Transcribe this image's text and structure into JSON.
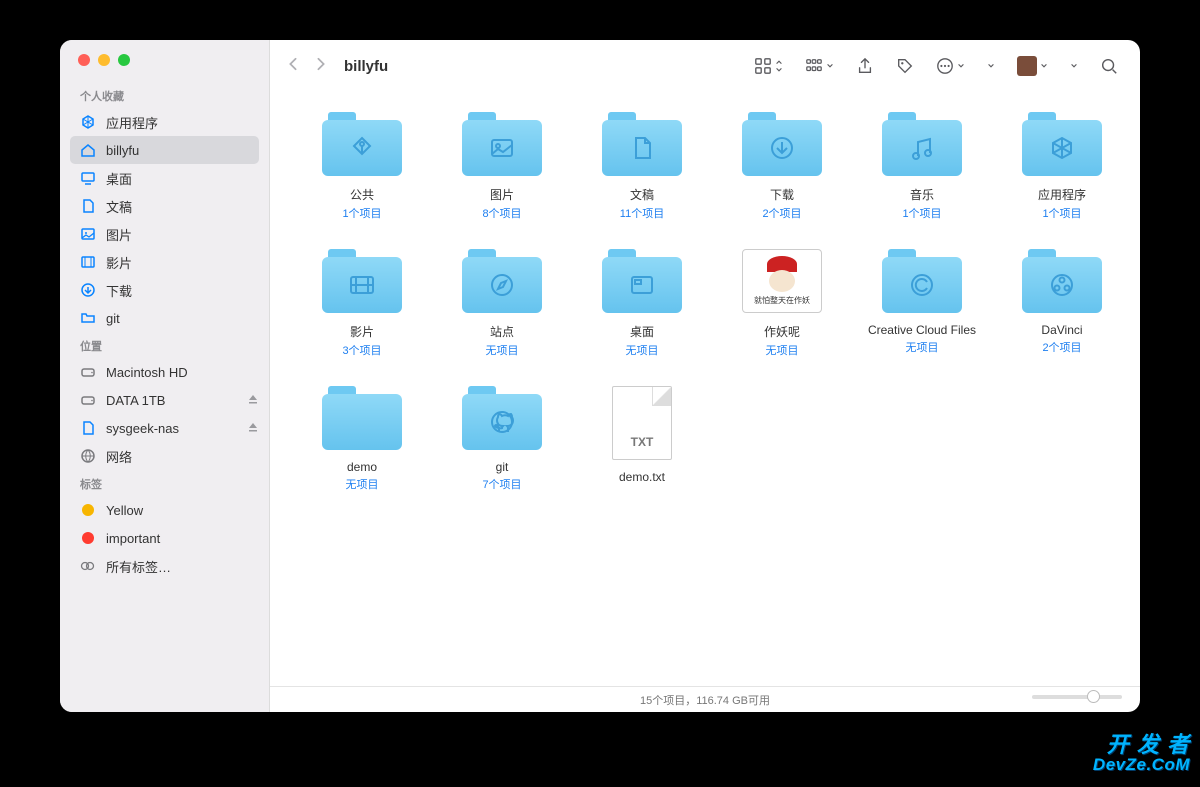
{
  "window": {
    "title": "billyfu"
  },
  "sidebar": {
    "sections": [
      {
        "label": "个人收藏",
        "items": [
          {
            "name": "应用程序",
            "icon": "app"
          },
          {
            "name": "billyfu",
            "icon": "home",
            "selected": true
          },
          {
            "name": "桌面",
            "icon": "desktop"
          },
          {
            "name": "文稿",
            "icon": "doc"
          },
          {
            "name": "图片",
            "icon": "picture"
          },
          {
            "name": "影片",
            "icon": "movie"
          },
          {
            "name": "下载",
            "icon": "download"
          },
          {
            "name": "git",
            "icon": "folder"
          }
        ]
      },
      {
        "label": "位置",
        "items": [
          {
            "name": "Macintosh HD",
            "icon": "disk"
          },
          {
            "name": "DATA 1TB",
            "icon": "disk",
            "eject": true
          },
          {
            "name": "sysgeek-nas",
            "icon": "doc",
            "eject": true
          },
          {
            "name": "网络",
            "icon": "globe"
          }
        ]
      },
      {
        "label": "标签",
        "items": [
          {
            "name": "Yellow",
            "icon": "tag",
            "color": "#f7b500"
          },
          {
            "name": "important",
            "icon": "tag",
            "color": "#ff3b30"
          },
          {
            "name": "所有标签…",
            "icon": "alltags"
          }
        ]
      }
    ]
  },
  "items": [
    {
      "name": "公共",
      "sub": "1个项目",
      "kind": "folder",
      "glyph": "public"
    },
    {
      "name": "图片",
      "sub": "8个项目",
      "kind": "folder",
      "glyph": "picture"
    },
    {
      "name": "文稿",
      "sub": "11个项目",
      "kind": "folder",
      "glyph": "doc"
    },
    {
      "name": "下载",
      "sub": "2个项目",
      "kind": "folder",
      "glyph": "download"
    },
    {
      "name": "音乐",
      "sub": "1个项目",
      "kind": "folder",
      "glyph": "music"
    },
    {
      "name": "应用程序",
      "sub": "1个项目",
      "kind": "folder",
      "glyph": "app"
    },
    {
      "name": "影片",
      "sub": "3个项目",
      "kind": "folder",
      "glyph": "movie"
    },
    {
      "name": "站点",
      "sub": "无项目",
      "kind": "folder",
      "glyph": "compass"
    },
    {
      "name": "桌面",
      "sub": "无项目",
      "kind": "folder",
      "glyph": "desktop"
    },
    {
      "name": "作妖呢",
      "sub": "无项目",
      "kind": "image",
      "caption": "就怕整天在作妖"
    },
    {
      "name": "Creative Cloud Files",
      "sub": "无项目",
      "kind": "folder",
      "glyph": "cc"
    },
    {
      "name": "DaVinci",
      "sub": "2个项目",
      "kind": "folder",
      "glyph": "davinci"
    },
    {
      "name": "demo",
      "sub": "无项目",
      "kind": "folder",
      "glyph": ""
    },
    {
      "name": "git",
      "sub": "7个项目",
      "kind": "folder",
      "glyph": "github"
    },
    {
      "name": "demo.txt",
      "sub": "",
      "kind": "txt",
      "label": "TXT"
    }
  ],
  "status": "15个项目，116.74 GB可用",
  "watermark": {
    "line1": "开 发 者",
    "line2": "DevZe.CoM"
  }
}
